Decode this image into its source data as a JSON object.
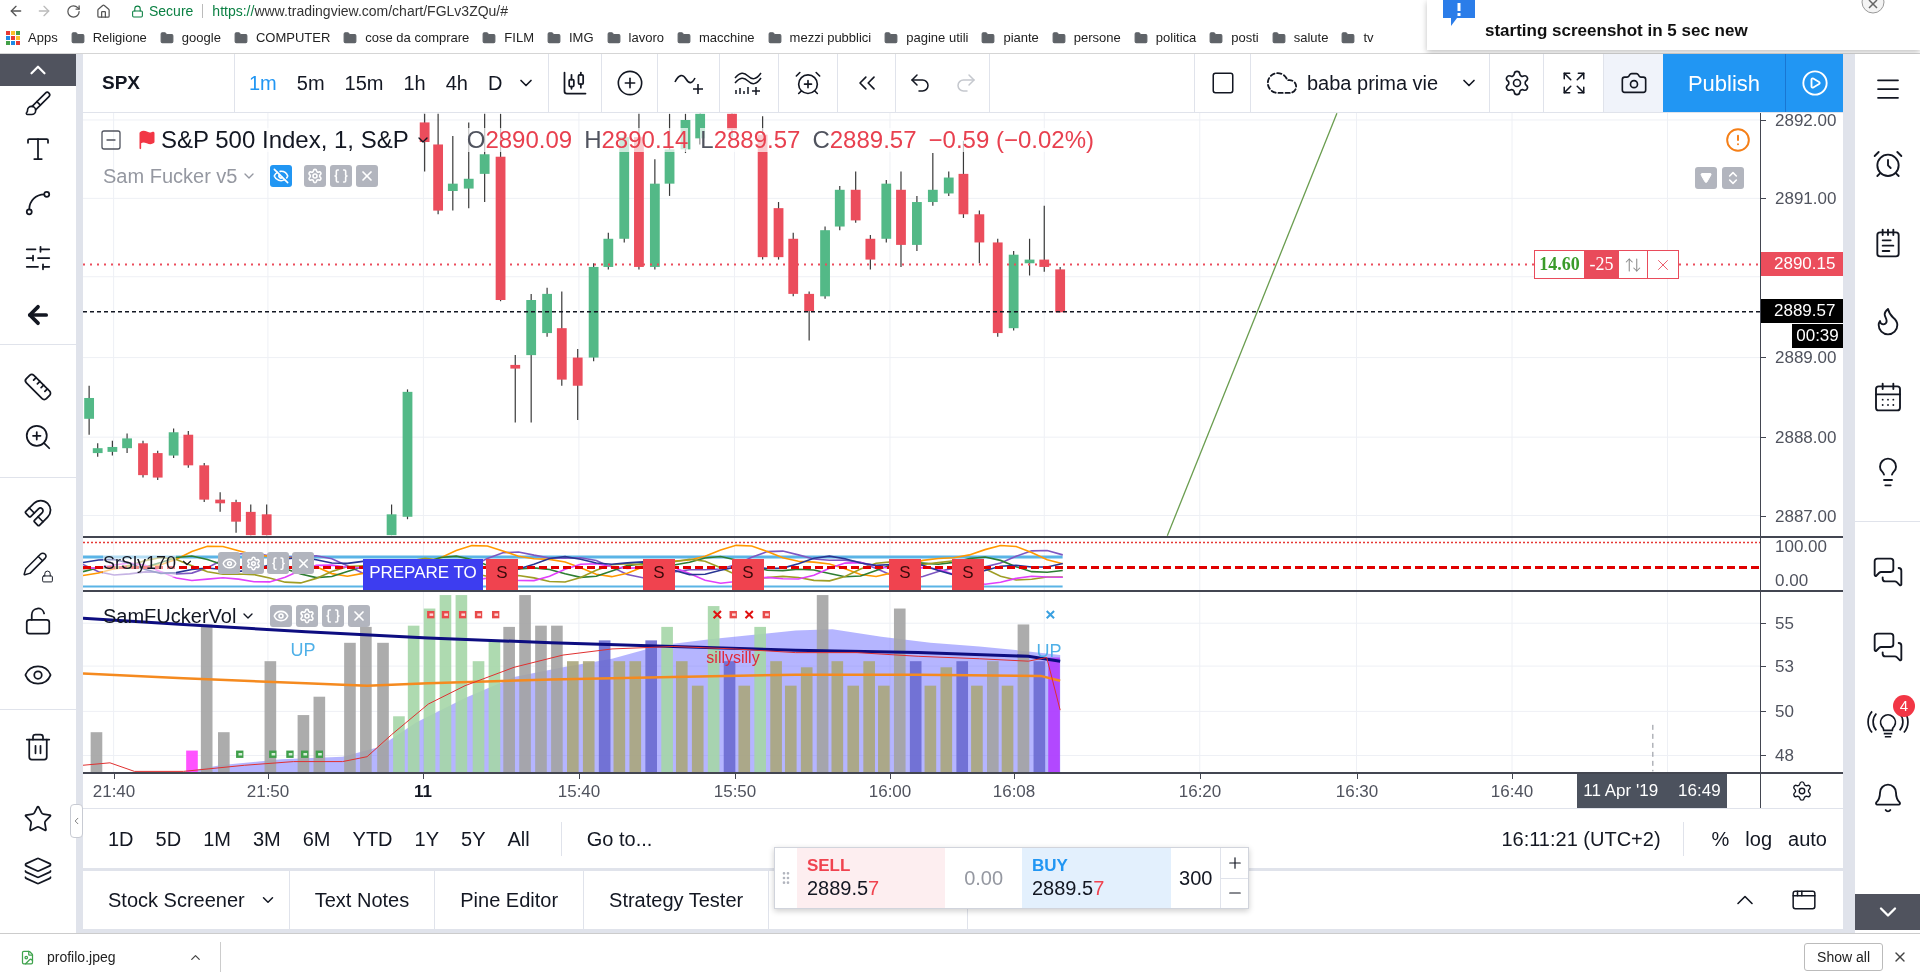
{
  "browser": {
    "secure_label": "Secure",
    "url_scheme": "https://",
    "url_rest": "www.tradingview.com/chart/FGLv3ZQu/#"
  },
  "bookmarks": [
    {
      "label": "Apps",
      "kind": "apps"
    },
    {
      "label": "Religione",
      "kind": "folder"
    },
    {
      "label": "google",
      "kind": "folder"
    },
    {
      "label": "COMPUTER",
      "kind": "folder"
    },
    {
      "label": "cose da comprare",
      "kind": "folder"
    },
    {
      "label": "FILM",
      "kind": "folder"
    },
    {
      "label": "IMG",
      "kind": "folder"
    },
    {
      "label": "lavoro",
      "kind": "folder"
    },
    {
      "label": "macchine",
      "kind": "folder"
    },
    {
      "label": "mezzi pubblici",
      "kind": "folder"
    },
    {
      "label": "pagine utili",
      "kind": "folder"
    },
    {
      "label": "piante",
      "kind": "folder"
    },
    {
      "label": "persone",
      "kind": "folder"
    },
    {
      "label": "politica",
      "kind": "folder"
    },
    {
      "label": "posti",
      "kind": "folder"
    },
    {
      "label": "salute",
      "kind": "folder"
    },
    {
      "label": "tv",
      "kind": "folder"
    }
  ],
  "notification": {
    "text": "starting screenshot in 5 sec new"
  },
  "toolbar": {
    "symbol": "SPX",
    "intervals": [
      {
        "label": "1m",
        "selected": true
      },
      {
        "label": "5m",
        "selected": false
      },
      {
        "label": "15m",
        "selected": false
      },
      {
        "label": "1h",
        "selected": false
      },
      {
        "label": "4h",
        "selected": false
      },
      {
        "label": "D",
        "selected": false
      }
    ],
    "history": [
      {
        "kind": "undo",
        "disabled": false
      },
      {
        "kind": "redo",
        "disabled": true
      }
    ],
    "layout_name": "baba prima vie",
    "publish": "Publish"
  },
  "legend": {
    "title": "S&P 500 Index, 1, S&P",
    "ohlc": [
      {
        "letter": "O",
        "value": "2890.09"
      },
      {
        "letter": "H",
        "value": "2890.14"
      },
      {
        "letter": "L",
        "value": "2889.57"
      },
      {
        "letter": "C",
        "value": "2889.57"
      }
    ],
    "change": "−0.59 (−0.02%)",
    "study": "Sam Fucker v5"
  },
  "price_axis": {
    "ticks": [
      "2892.00",
      "2891.00",
      "2889.00",
      "2888.00",
      "2887.00"
    ],
    "order_price": "2890.15",
    "last_price": "2889.57",
    "countdown": "00:39"
  },
  "order": {
    "profit": "14.60",
    "quantity": "-25"
  },
  "oscillator": {
    "name": "SrSly170",
    "signal": "PREPARE TO",
    "marks": [
      "S",
      "S",
      "S",
      "S",
      "S"
    ],
    "ticks": [
      "100.00",
      "0.00"
    ]
  },
  "volume": {
    "name": "SamFUckerVol",
    "labels": [
      {
        "text": "UP",
        "kind": "up"
      },
      {
        "text": "sillysilly",
        "kind": "alert"
      },
      {
        "text": "UP",
        "kind": "up"
      }
    ],
    "ticks": [
      "55",
      "53",
      "50",
      "48"
    ]
  },
  "time_axis": {
    "ticks": [
      {
        "label": "21:40",
        "kind": "time"
      },
      {
        "label": "21:50",
        "kind": "time"
      },
      {
        "label": "11",
        "kind": "day"
      },
      {
        "label": "15:40",
        "kind": "time"
      },
      {
        "label": "15:50",
        "kind": "time"
      },
      {
        "label": "16:00",
        "kind": "time"
      },
      {
        "label": "16:08",
        "kind": "time"
      },
      {
        "label": "16:20",
        "kind": "time"
      },
      {
        "label": "16:30",
        "kind": "time"
      },
      {
        "label": "16:40",
        "kind": "time"
      }
    ],
    "crosshair": {
      "date": "11 Apr '19",
      "time": "16:49"
    }
  },
  "range_bar": {
    "ranges": [
      "1D",
      "5D",
      "1M",
      "3M",
      "6M",
      "YTD",
      "1Y",
      "5Y",
      "All"
    ],
    "goto": "Go to...",
    "clock": "16:11:21 (UTC+2)",
    "scale_modes": [
      "%",
      "log",
      "auto"
    ]
  },
  "trade_panel": {
    "sell": {
      "label": "SELL",
      "price": "2889.57"
    },
    "spread": "0.00",
    "buy": {
      "label": "BUY",
      "price": "2889.57"
    },
    "quantity": "300"
  },
  "bottom_tabs": [
    {
      "label": "Stock Screener",
      "dropdown": true
    },
    {
      "label": "Text Notes",
      "dropdown": false
    },
    {
      "label": "Pine Editor",
      "dropdown": false
    },
    {
      "label": "Strategy Tester",
      "dropdown": false
    }
  ],
  "sidebar": {
    "badge": "4"
  },
  "downloads": {
    "file": "profilo.jpeg",
    "show_all": "Show all"
  }
}
